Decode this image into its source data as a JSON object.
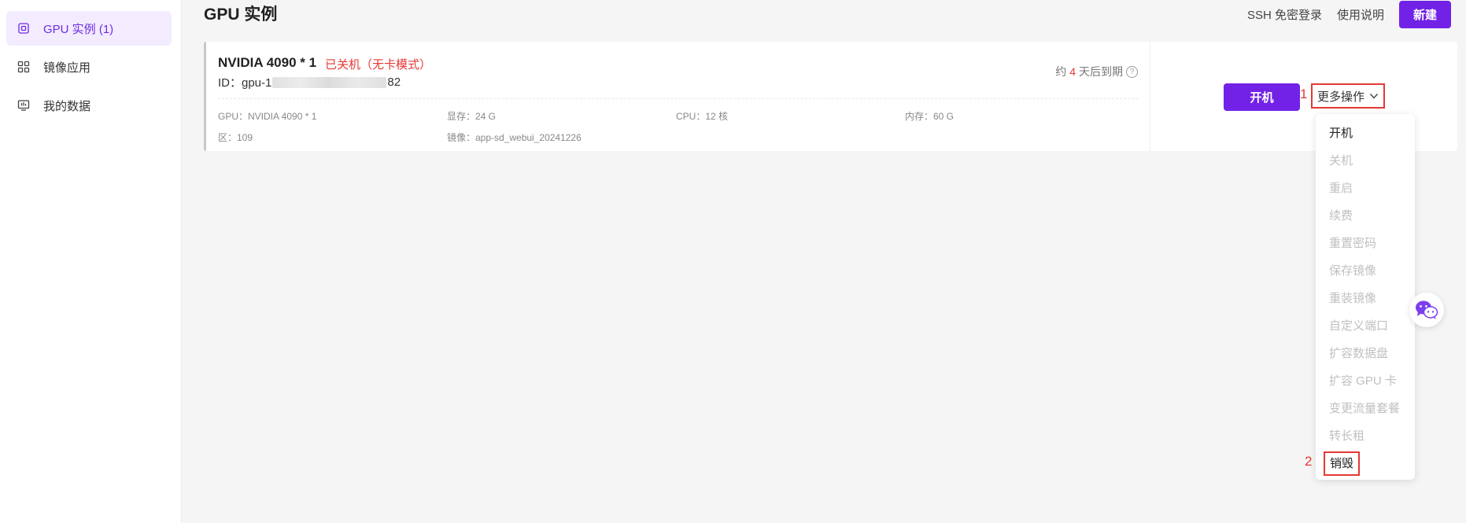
{
  "sidebar": {
    "items": [
      {
        "label": "GPU 实例 (1)",
        "icon": "chip-icon"
      },
      {
        "label": "镜像应用",
        "icon": "grid-icon"
      },
      {
        "label": "我的数据",
        "icon": "monitor-icon"
      }
    ]
  },
  "header": {
    "title": "GPU 实例",
    "ssh_label": "SSH 免密登录",
    "docs_label": "使用说明",
    "new_label": "新建"
  },
  "instance": {
    "name": "NVIDIA 4090 * 1",
    "status": "已关机（无卡模式）",
    "id_prefix": "ID：gpu-1",
    "id_suffix": "82",
    "expire_prefix": "约",
    "expire_days": "4",
    "expire_suffix": "天后到期",
    "specs": {
      "gpu": "GPU：NVIDIA 4090 * 1",
      "vram": "显存：24 G",
      "cpu": "CPU：12 核",
      "memory": "内存：60 G",
      "region": "区：109",
      "image": "镜像：app-sd_webui_20241226"
    },
    "start_label": "开机",
    "more_label": "更多操作"
  },
  "annotations": {
    "step1": "1",
    "step2": "2"
  },
  "dropdown": {
    "items": [
      {
        "label": "开机",
        "enabled": true
      },
      {
        "label": "关机",
        "enabled": false
      },
      {
        "label": "重启",
        "enabled": false
      },
      {
        "label": "续费",
        "enabled": false
      },
      {
        "label": "重置密码",
        "enabled": false
      },
      {
        "label": "保存镜像",
        "enabled": false
      },
      {
        "label": "重装镜像",
        "enabled": false
      },
      {
        "label": "自定义端口",
        "enabled": false
      },
      {
        "label": "扩容数据盘",
        "enabled": false
      },
      {
        "label": "扩容 GPU 卡",
        "enabled": false
      },
      {
        "label": "变更流量套餐",
        "enabled": false
      },
      {
        "label": "转长租",
        "enabled": false
      },
      {
        "label": "销毁",
        "enabled": true
      }
    ]
  },
  "colors": {
    "accent": "#7222e6",
    "danger": "#e53935",
    "active_bg": "#f3ecff"
  }
}
